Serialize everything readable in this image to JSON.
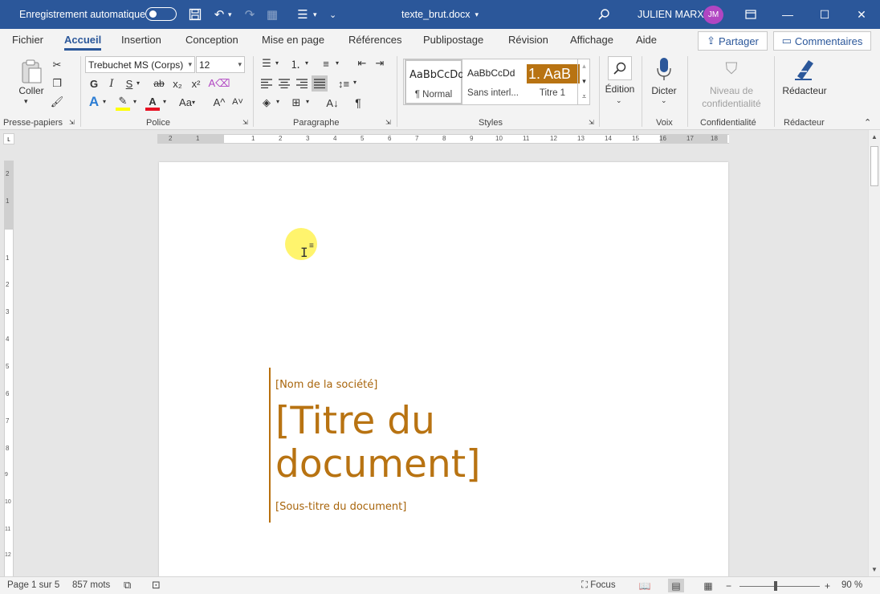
{
  "titlebar": {
    "autosave_label": "Enregistrement automatique",
    "doc_title": "texte_brut.docx",
    "doc_title_arrow": "▾",
    "user_name": "JULIEN MARX",
    "user_initials": "JM",
    "bg_color": "#2b579a"
  },
  "menu": {
    "tabs": [
      "Fichier",
      "Accueil",
      "Insertion",
      "Conception",
      "Mise en page",
      "Références",
      "Publipostage",
      "Révision",
      "Affichage",
      "Aide"
    ],
    "active_tab": "Accueil",
    "share_label": "Partager",
    "comments_label": "Commentaires"
  },
  "ribbon": {
    "clipboard": {
      "paste_label": "Coller",
      "group_label": "Presse-papiers"
    },
    "font": {
      "family": "Trebuchet MS (Corps)",
      "size": "12",
      "bold": "G",
      "italic": "I",
      "underline": "S",
      "strike": "ab",
      "subscript": "x₂",
      "superscript": "x²",
      "case_label": "Aa",
      "grow_label": "A^",
      "shrink_label": "A˅",
      "group_label": "Police"
    },
    "paragraph": {
      "pilcrow": "¶",
      "group_label": "Paragraphe"
    },
    "styles": {
      "items": [
        {
          "sample": "AaBbCcDd",
          "name": "¶ Normal"
        },
        {
          "sample": "AaBbCcDd",
          "name": "Sans interl..."
        },
        {
          "sample": "1. AaB",
          "name": "Titre 1"
        }
      ],
      "group_label": "Styles"
    },
    "editing": {
      "label": "Édition"
    },
    "voice": {
      "label": "Dicter",
      "group_label": "Voix"
    },
    "sensitivity": {
      "label_line1": "Niveau de",
      "label_line2": "confidentialité",
      "group_label": "Confidentialité"
    },
    "editor": {
      "label": "Rédacteur",
      "group_label": "Rédacteur"
    }
  },
  "ruler": {
    "left_labels": [
      "2",
      "1"
    ],
    "right_labels": [
      "1",
      "2",
      "3",
      "4",
      "5",
      "6",
      "7",
      "8",
      "9",
      "10",
      "11",
      "12",
      "13",
      "14",
      "15",
      "16",
      "17",
      "18"
    ],
    "vertical_labels": [
      "2",
      "1",
      "1",
      "2",
      "3",
      "4",
      "5",
      "6",
      "7",
      "8",
      "9",
      "10",
      "11",
      "12"
    ]
  },
  "document": {
    "company": "[Nom de la société]",
    "title": "[Titre du document]",
    "subtitle": "[Sous-titre du document]",
    "accent_color": "#b87312"
  },
  "status": {
    "page": "Page 1 sur 5",
    "words": "857 mots",
    "focus_label": "Focus",
    "zoom": "90 %"
  }
}
